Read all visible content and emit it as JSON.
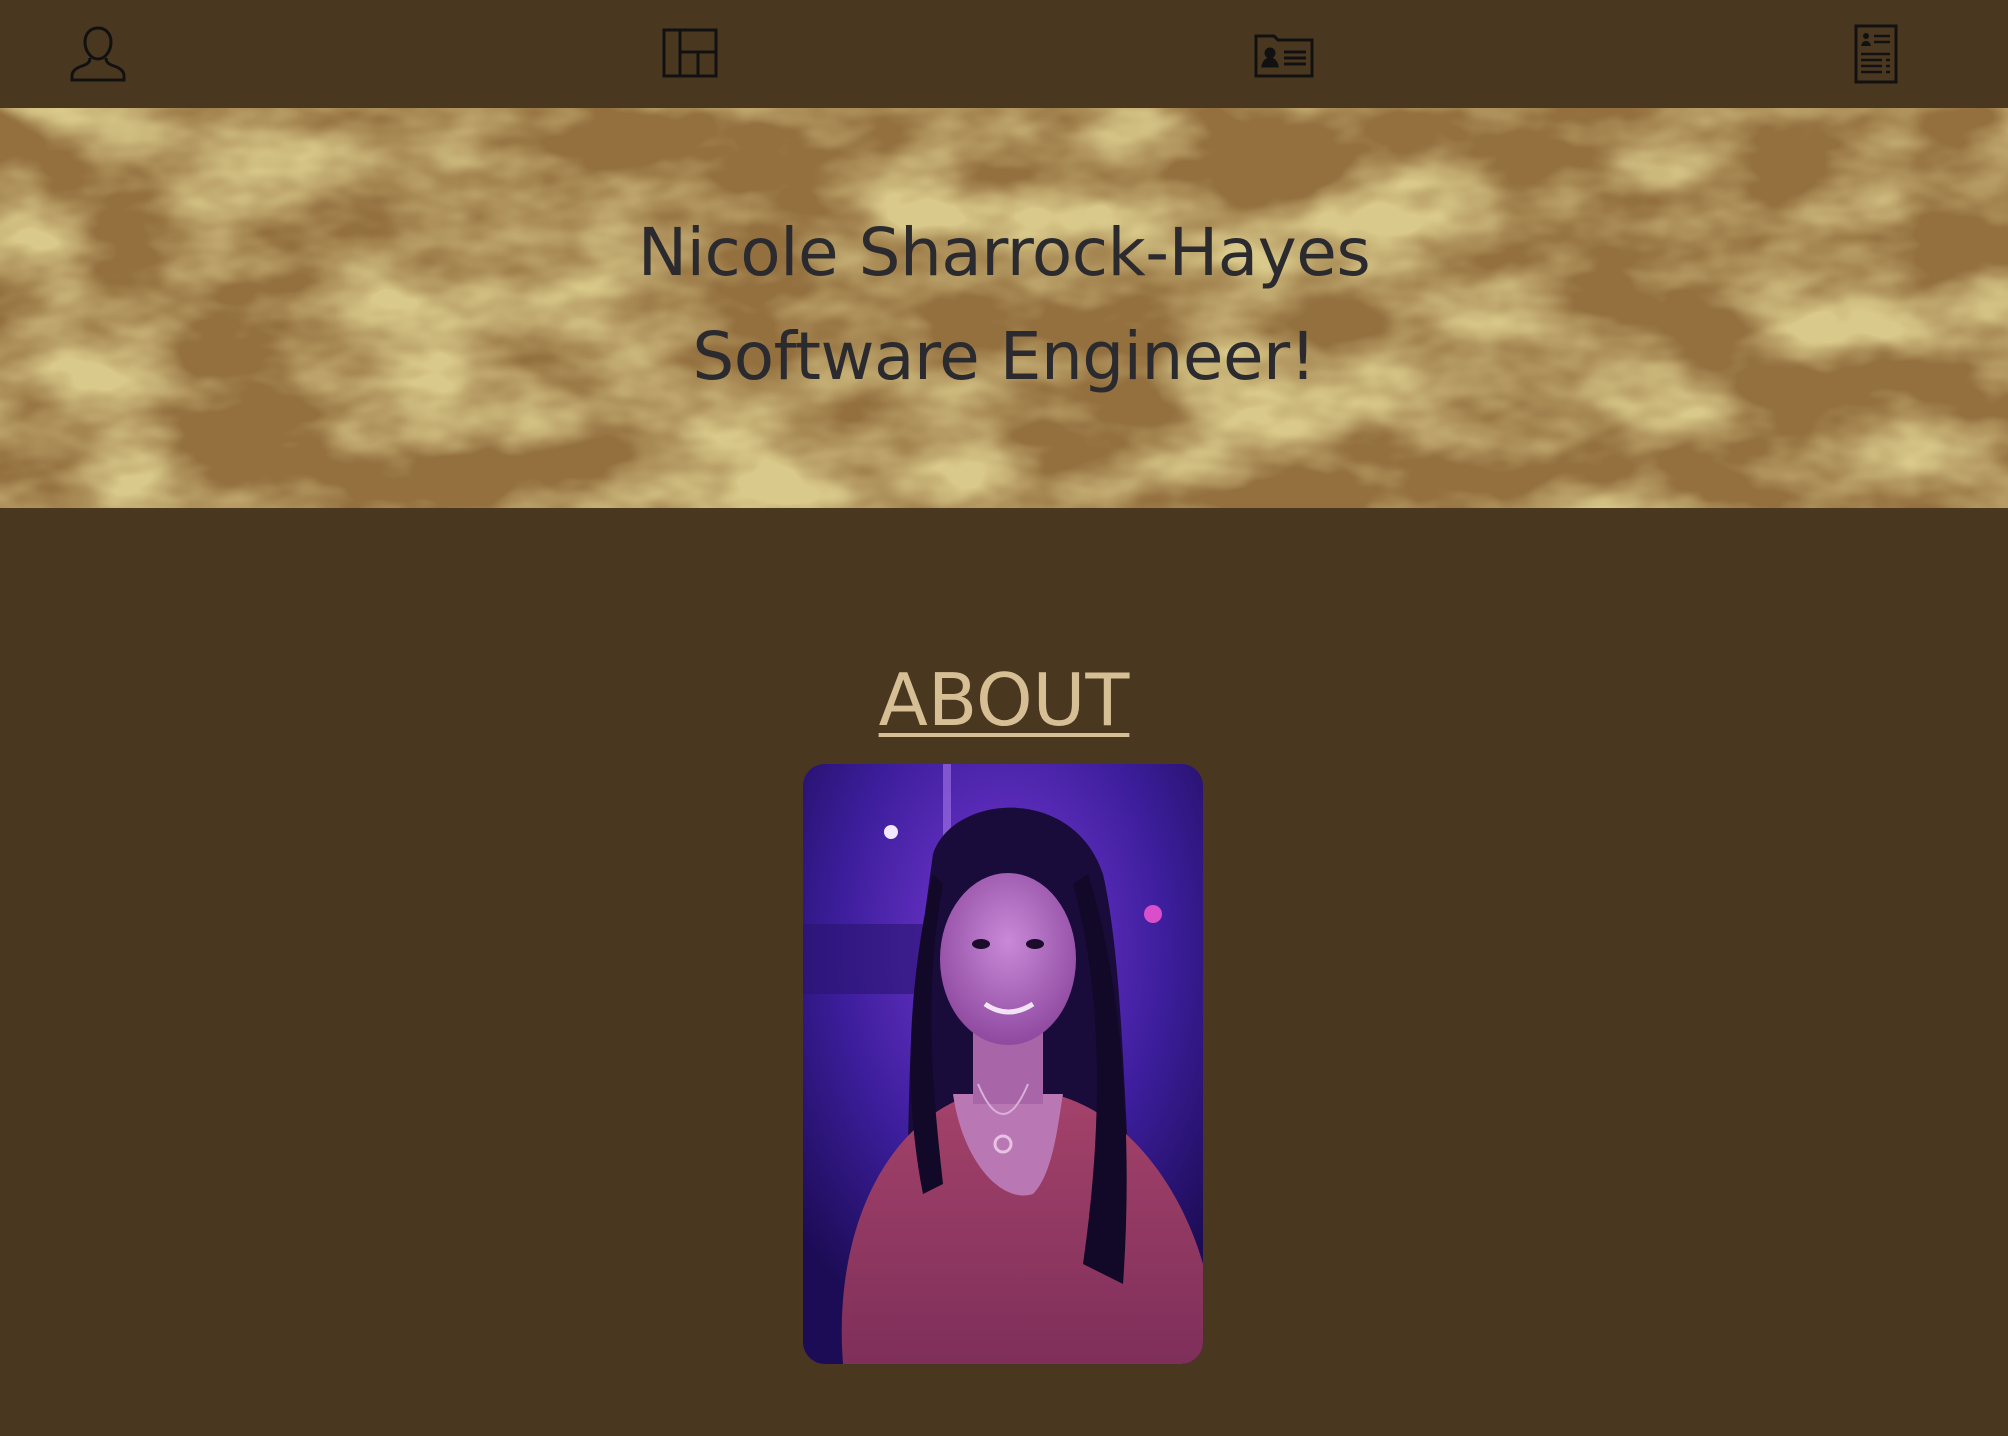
{
  "nav": {
    "items": [
      {
        "icon": "person-icon",
        "target": "about"
      },
      {
        "icon": "layout-grid-icon",
        "target": "portfolio"
      },
      {
        "icon": "contact-card-icon",
        "target": "contact"
      },
      {
        "icon": "resume-document-icon",
        "target": "resume"
      }
    ]
  },
  "hero": {
    "name": "Nicole Sharrock-Hayes",
    "subtitle": "Software Engineer!"
  },
  "about": {
    "heading": "ABOUT",
    "photo_alt": "Nicole Sharrock-Hayes"
  },
  "colors": {
    "page_background": "#4a3720",
    "banner_gold": "#c9ab6a",
    "banner_brown": "#8f6a3b",
    "heading_color": "#d6be95",
    "hero_text": "#2b2b2f"
  }
}
